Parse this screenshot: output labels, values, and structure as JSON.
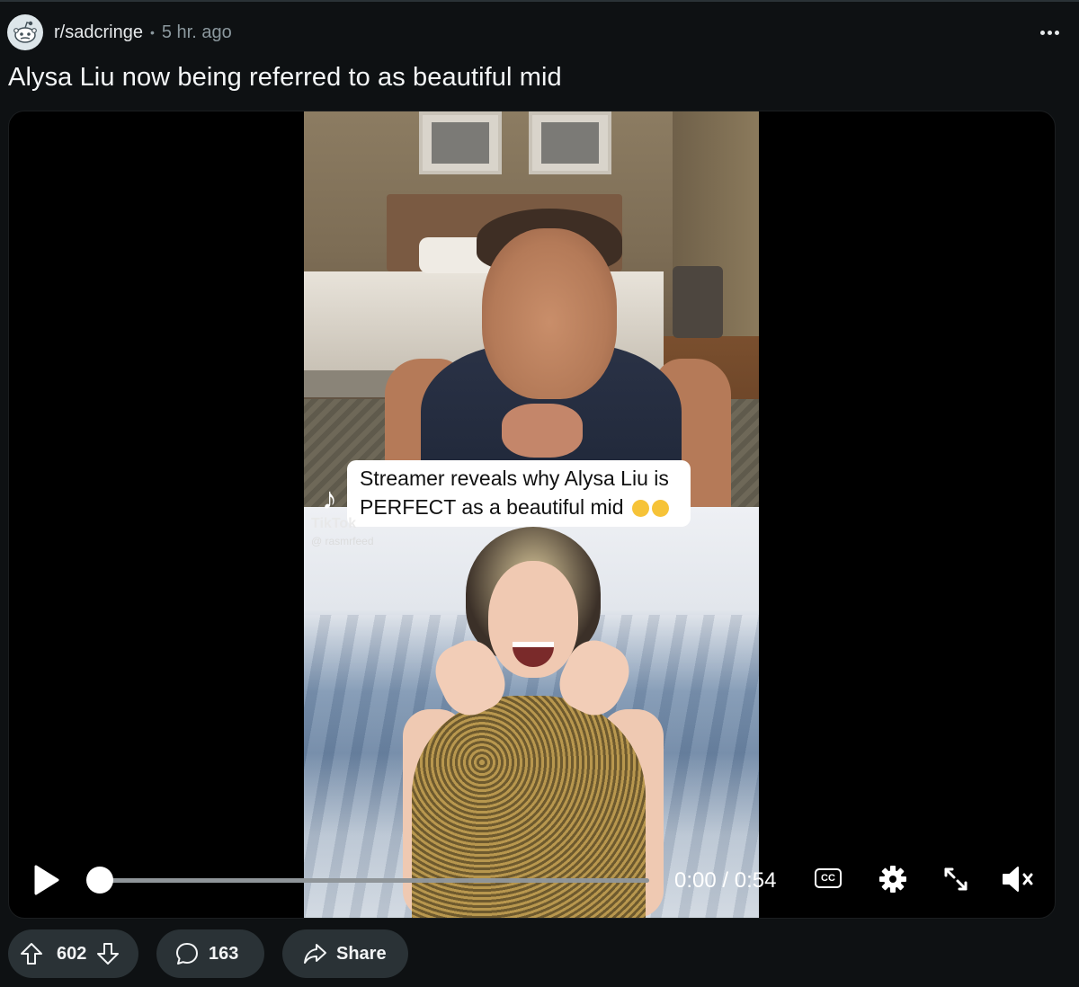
{
  "post": {
    "subreddit": "r/sadcringe",
    "separator": "•",
    "time_ago": "5 hr. ago",
    "title": "Alysa Liu now being referred to as beautiful mid",
    "more_icon": "more-horizontal-icon"
  },
  "video": {
    "caption_line1": "Streamer reveals why Alysa Liu is",
    "caption_line2": "PERFECT as a beautiful mid",
    "watermark_brand": "TikTok",
    "watermark_handle": "@ rasmrfeed",
    "time_readout": "0:00 / 0:54",
    "progress": 0.0,
    "cc_label": "CC",
    "icons": [
      "play-icon",
      "closed-captions-icon",
      "settings-gear-icon",
      "expand-icon",
      "muted-speaker-icon"
    ]
  },
  "actions": {
    "upvotes": "602",
    "comments": "163",
    "share_label": "Share"
  },
  "colors": {
    "background": "#0e1113",
    "pill": "#2a3236",
    "text": "#f2f4f5",
    "muted": "#8b989e"
  }
}
